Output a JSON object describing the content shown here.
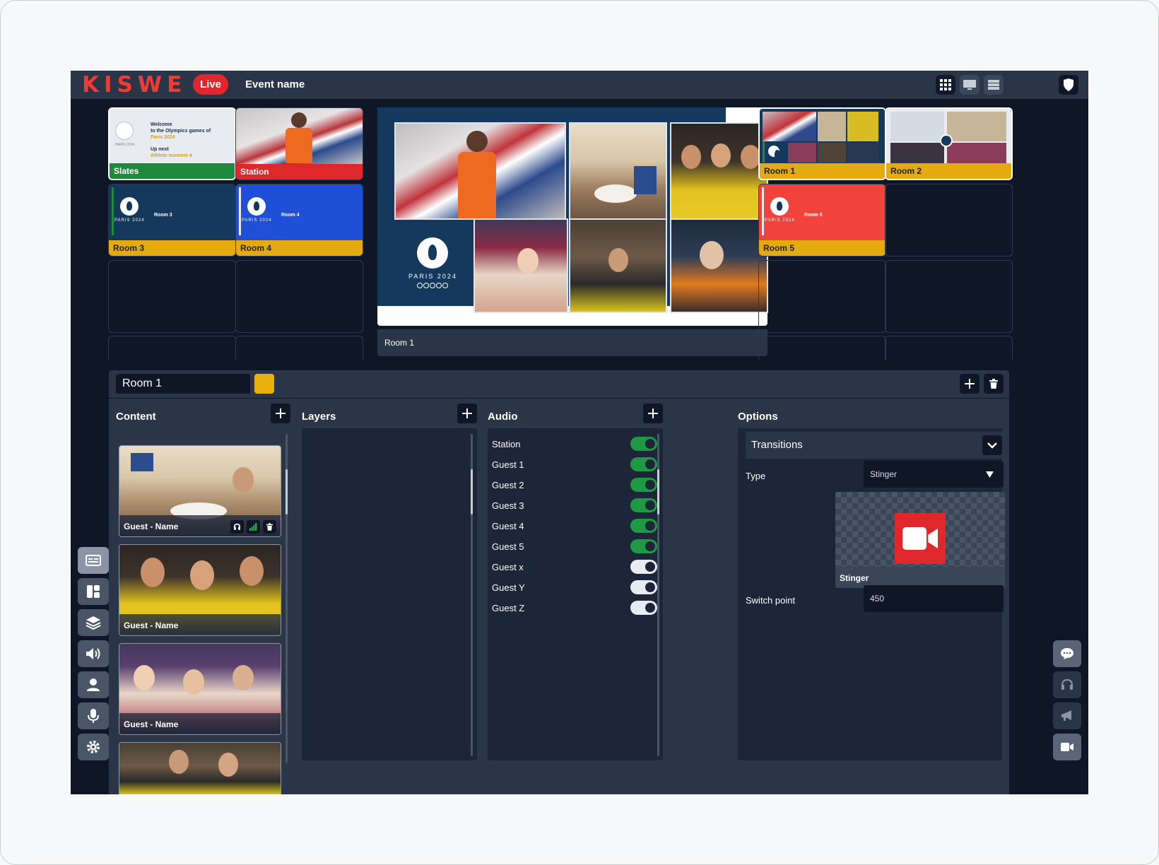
{
  "header": {
    "logo": "KISWE",
    "live_label": "Live",
    "event_name": "Event name"
  },
  "sources": {
    "slates": {
      "label": "Slates",
      "slate_line1": "Welcome",
      "slate_line2": "to the Olympics games of",
      "slate_line3": "Paris 2024",
      "slate_line4": "Up next",
      "slate_line5": "Athlete moment 4"
    },
    "station": {
      "label": "Station"
    },
    "room3": {
      "label": "Room 3",
      "thumb_text": "Room 3"
    },
    "room4": {
      "label": "Room 4",
      "thumb_text": "Room 4"
    },
    "room1": {
      "label": "Room 1"
    },
    "room2": {
      "label": "Room 2"
    },
    "room5": {
      "label": "Room 5",
      "thumb_text": "Room 5"
    },
    "paris_text": "PARIS 2024"
  },
  "program": {
    "label": "Room 1",
    "paris_text": "PARIS 2024"
  },
  "editor": {
    "room_name": "Room 1",
    "room_color": "#e8b10d",
    "content_title": "Content",
    "layers_title": "Layers",
    "audio_title": "Audio",
    "options_title": "Options",
    "content_items": [
      {
        "label": "Guest - Name"
      },
      {
        "label": "Guest - Name"
      },
      {
        "label": "Guest - Name"
      },
      {
        "label": ""
      }
    ],
    "audio": [
      {
        "label": "Station",
        "on": true
      },
      {
        "label": "Guest 1",
        "on": true
      },
      {
        "label": "Guest 2",
        "on": true
      },
      {
        "label": "Guest 3",
        "on": true
      },
      {
        "label": "Guest 4",
        "on": true
      },
      {
        "label": "Guest 5",
        "on": true
      },
      {
        "label": "Guest x",
        "on": false
      },
      {
        "label": "Guest Y",
        "on": false
      },
      {
        "label": "Guest Z",
        "on": false
      }
    ],
    "options": {
      "transitions_title": "Transitions",
      "type_label": "Type",
      "type_value": "Stinger",
      "stinger_label": "Stinger",
      "switch_point_label": "Switch point",
      "switch_point_value": "450"
    }
  },
  "colors": {
    "brand": "#ef3b33",
    "live": "#e3262d",
    "slates": "#1f8a3e",
    "station": "#e0282c",
    "room": "#e5aa10",
    "toggle_on": "#1e9944"
  }
}
